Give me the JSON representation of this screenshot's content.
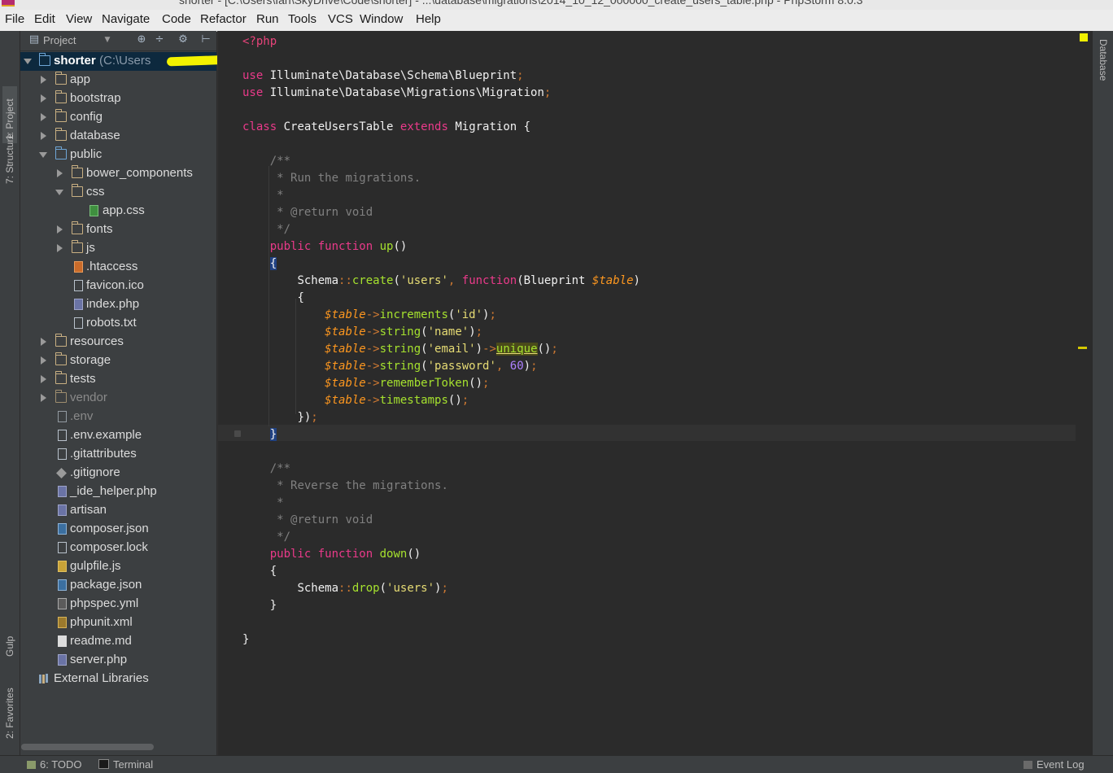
{
  "window": {
    "title": "shorter - [C:\\Users\\Ian\\SkyDrive\\Code\\shorter] - ...\\database\\migrations\\2014_10_12_000000_create_users_table.php - PhpStorm 8.0.3"
  },
  "menu": [
    "File",
    "Edit",
    "View",
    "Navigate",
    "Code",
    "Refactor",
    "Run",
    "Tools",
    "VCS",
    "Window",
    "Help"
  ],
  "left_tabs": {
    "project": "1: Project",
    "structure": "7: Structure",
    "gulp": "Gulp",
    "favorites": "2: Favorites"
  },
  "right_tabs": {
    "database": "Database"
  },
  "project_panel": {
    "title": "Project"
  },
  "tree": [
    {
      "label": "shorter",
      "path": "(C:\\Users",
      "bold": true
    },
    {
      "label": "app"
    },
    {
      "label": "bootstrap"
    },
    {
      "label": "config"
    },
    {
      "label": "database"
    },
    {
      "label": "public"
    },
    {
      "label": "bower_components"
    },
    {
      "label": "css"
    },
    {
      "label": "app.css"
    },
    {
      "label": "fonts"
    },
    {
      "label": "js"
    },
    {
      "label": ".htaccess"
    },
    {
      "label": "favicon.ico"
    },
    {
      "label": "index.php"
    },
    {
      "label": "robots.txt"
    },
    {
      "label": "resources"
    },
    {
      "label": "storage"
    },
    {
      "label": "tests"
    },
    {
      "label": "vendor"
    },
    {
      "label": ".env"
    },
    {
      "label": ".env.example"
    },
    {
      "label": ".gitattributes"
    },
    {
      "label": ".gitignore"
    },
    {
      "label": "_ide_helper.php"
    },
    {
      "label": "artisan"
    },
    {
      "label": "composer.json"
    },
    {
      "label": "composer.lock"
    },
    {
      "label": "gulpfile.js"
    },
    {
      "label": "package.json"
    },
    {
      "label": "phpspec.yml"
    },
    {
      "label": "phpunit.xml"
    },
    {
      "label": "readme.md"
    },
    {
      "label": "server.php"
    },
    {
      "label": "External Libraries"
    }
  ],
  "code": {
    "open_tag": "<?php",
    "use1": "Illuminate\\Database\\Schema\\Blueprint",
    "use2": "Illuminate\\Database\\Migrations\\Migration",
    "class_name": "CreateUsersTable",
    "parent": "Migration",
    "doc_up": "* Run the migrations.",
    "doc_down": "* Reverse the migrations.",
    "doc_return": "* @return void",
    "fn_up": "up",
    "fn_down": "down",
    "table_name": "'users'",
    "col_id": "'id'",
    "col_name": "'name'",
    "col_email": "'email'",
    "col_password": "'password'",
    "pw_len": "60"
  },
  "status": {
    "todo": "6: TODO",
    "terminal": "Terminal",
    "event_log": "Event Log"
  }
}
